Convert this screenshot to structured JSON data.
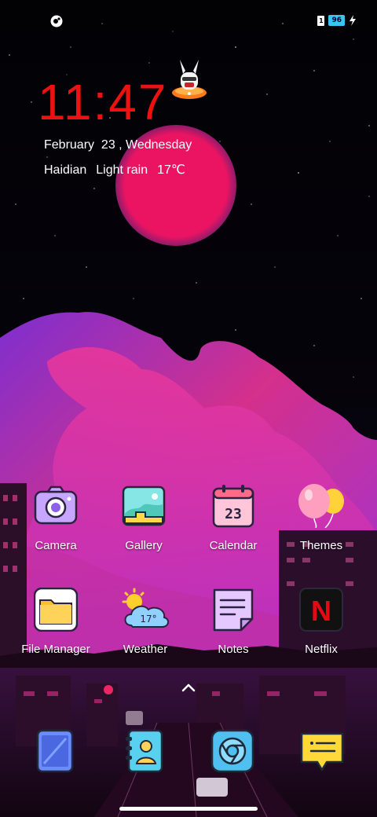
{
  "status_bar": {
    "sim_label": "1",
    "battery_level": "96"
  },
  "lock": {
    "time": "11:47",
    "date": "February  23 , Wednesday",
    "location": "Haidian",
    "condition": "Light rain",
    "temperature": "17℃"
  },
  "apps": [
    {
      "label": "Camera",
      "icon": "camera-icon"
    },
    {
      "label": "Gallery",
      "icon": "gallery-icon"
    },
    {
      "label": "Calendar",
      "icon": "calendar-icon",
      "day": "23"
    },
    {
      "label": "Themes",
      "icon": "balloons-icon"
    },
    {
      "label": "File Manager",
      "icon": "folder-icon"
    },
    {
      "label": "Weather",
      "icon": "weather-icon",
      "temp": "17°"
    },
    {
      "label": "Notes",
      "icon": "notes-icon"
    },
    {
      "label": "Netflix",
      "icon": "netflix-icon",
      "letter": "N"
    }
  ],
  "dock": [
    {
      "icon": "tablet-icon"
    },
    {
      "icon": "contacts-icon"
    },
    {
      "icon": "browser-icon"
    },
    {
      "icon": "messages-icon"
    }
  ],
  "colors": {
    "clock": "#ee1111",
    "sun": "#e8155f",
    "cloud_pink": "#e0307a",
    "cloud_purple": "#8d2fd6",
    "battery": "#39c5f0"
  }
}
